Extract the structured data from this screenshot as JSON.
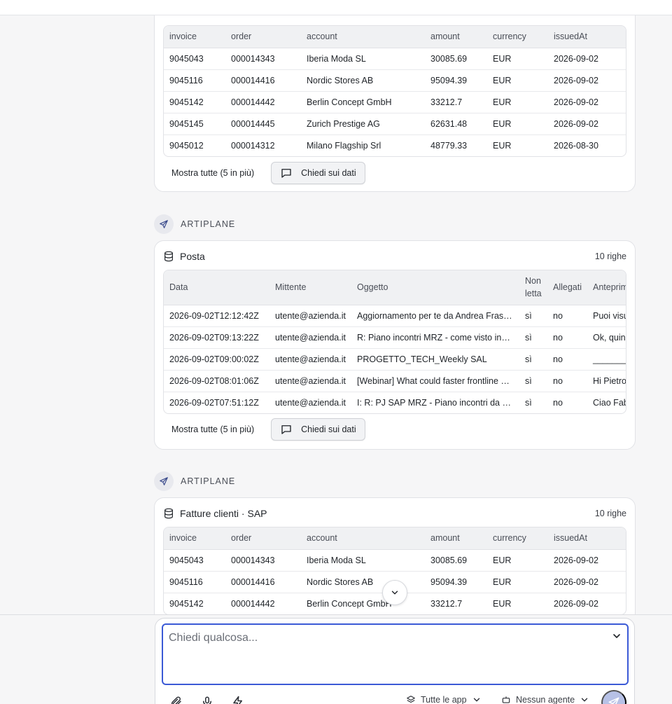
{
  "invoice_columns": [
    "invoice",
    "order",
    "account",
    "amount",
    "currency",
    "issuedAt"
  ],
  "invoice_rows_top": [
    [
      "9045043",
      "000014343",
      "Iberia Moda SL",
      "30085.69",
      "EUR",
      "2026-09-02"
    ],
    [
      "9045116",
      "000014416",
      "Nordic Stores AB",
      "95094.39",
      "EUR",
      "2026-09-02"
    ],
    [
      "9045142",
      "000014442",
      "Berlin Concept GmbH",
      "33212.7",
      "EUR",
      "2026-09-02"
    ],
    [
      "9045145",
      "000014445",
      "Zurich Prestige AG",
      "62631.48",
      "EUR",
      "2026-09-02"
    ],
    [
      "9045012",
      "000014312",
      "Milano Flagship Srl",
      "48779.33",
      "EUR",
      "2026-08-30"
    ]
  ],
  "card1": {
    "show_all": "Mostra tutte (5 in più)",
    "ask": "Chiedi sui dati"
  },
  "source2": {
    "name": "ARTIPLANE"
  },
  "card2": {
    "title": "Posta",
    "rows_count": "10 righe",
    "columns": [
      "Data",
      "Mittente",
      "Oggetto",
      "Non letta",
      "Allegati",
      "Anteprima"
    ],
    "rows": [
      [
        "2026-09-02T12:12:42Z",
        "utente@azienda.it",
        "Aggiornamento per te da Andrea Frascati",
        "sì",
        "no",
        "Puoi visualizzare"
      ],
      [
        "2026-09-02T09:13:22Z",
        "utente@azienda.it",
        "R: Piano incontri MRZ - come visto insieme",
        "sì",
        "no",
        "Ok, quindi"
      ],
      [
        "2026-09-02T09:00:02Z",
        "utente@azienda.it",
        "PROGETTO_TECH_Weekly SAL",
        "sì",
        "no",
        "______________"
      ],
      [
        "2026-09-02T08:01:06Z",
        "utente@azienda.it",
        "[Webinar] What could faster frontline hiring look like",
        "sì",
        "no",
        "Hi Pietro"
      ],
      [
        "2026-09-02T07:51:12Z",
        "utente@azienda.it",
        "I: R: PJ SAP MRZ - Piano incontri da settembre",
        "sì",
        "no",
        "Ciao Fabio"
      ]
    ],
    "show_all": "Mostra tutte (5 in più)",
    "ask": "Chiedi sui dati"
  },
  "source3": {
    "name": "ARTIPLANE"
  },
  "card3": {
    "title": "Fatture clienti · SAP",
    "rows_count": "10 righe"
  },
  "invoice_rows_bottom": [
    [
      "9045043",
      "000014343",
      "Iberia Moda SL",
      "30085.69",
      "EUR",
      "2026-09-02"
    ],
    [
      "9045116",
      "000014416",
      "Nordic Stores AB",
      "95094.39",
      "EUR",
      "2026-09-02"
    ],
    [
      "9045142",
      "000014442",
      "Berlin Concept GmbH",
      "33212.7",
      "EUR",
      "2026-09-02"
    ]
  ],
  "composer": {
    "placeholder": "Chiedi qualcosa...",
    "apps_label": "Tutte le app",
    "agent_label": "Nessun agente"
  }
}
